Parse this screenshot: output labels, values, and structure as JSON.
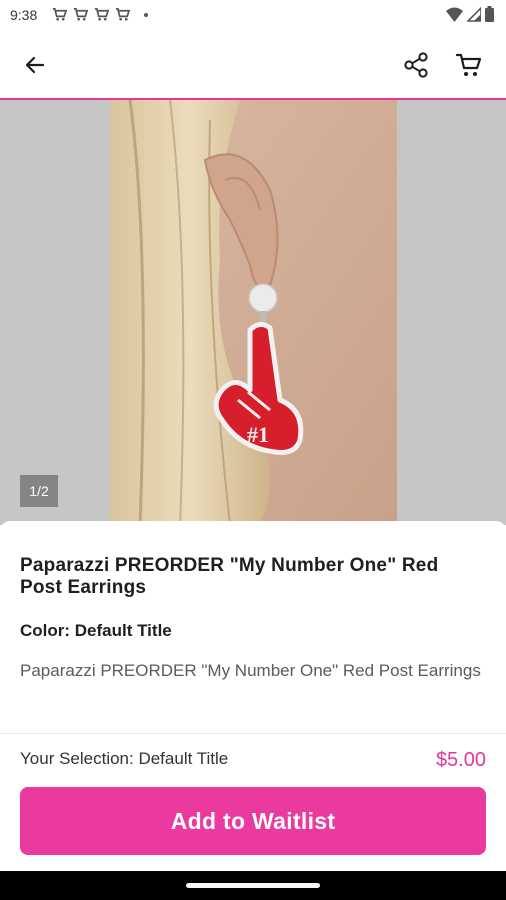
{
  "status_bar": {
    "time": "9:38",
    "notification_icons": [
      "cart-icon",
      "cart-icon",
      "cart-icon",
      "cart-icon"
    ]
  },
  "toolbar": {
    "back_icon": "arrow-left-icon",
    "share_icon": "share-icon",
    "cart_icon": "cart-icon"
  },
  "gallery": {
    "page_indicator": "1/2"
  },
  "product": {
    "title": "Paparazzi PREORDER \"My Number One\" Red Post Earrings",
    "color_line": "Color: Default Title",
    "description": "Paparazzi PREORDER \"My Number One\" Red Post Earrings",
    "selection": "Your Selection: Default Title",
    "price": "$5.00",
    "cta_label": "Add to Waitlist"
  },
  "colors": {
    "accent": "#ea3aa0",
    "price": "#e4369c"
  }
}
